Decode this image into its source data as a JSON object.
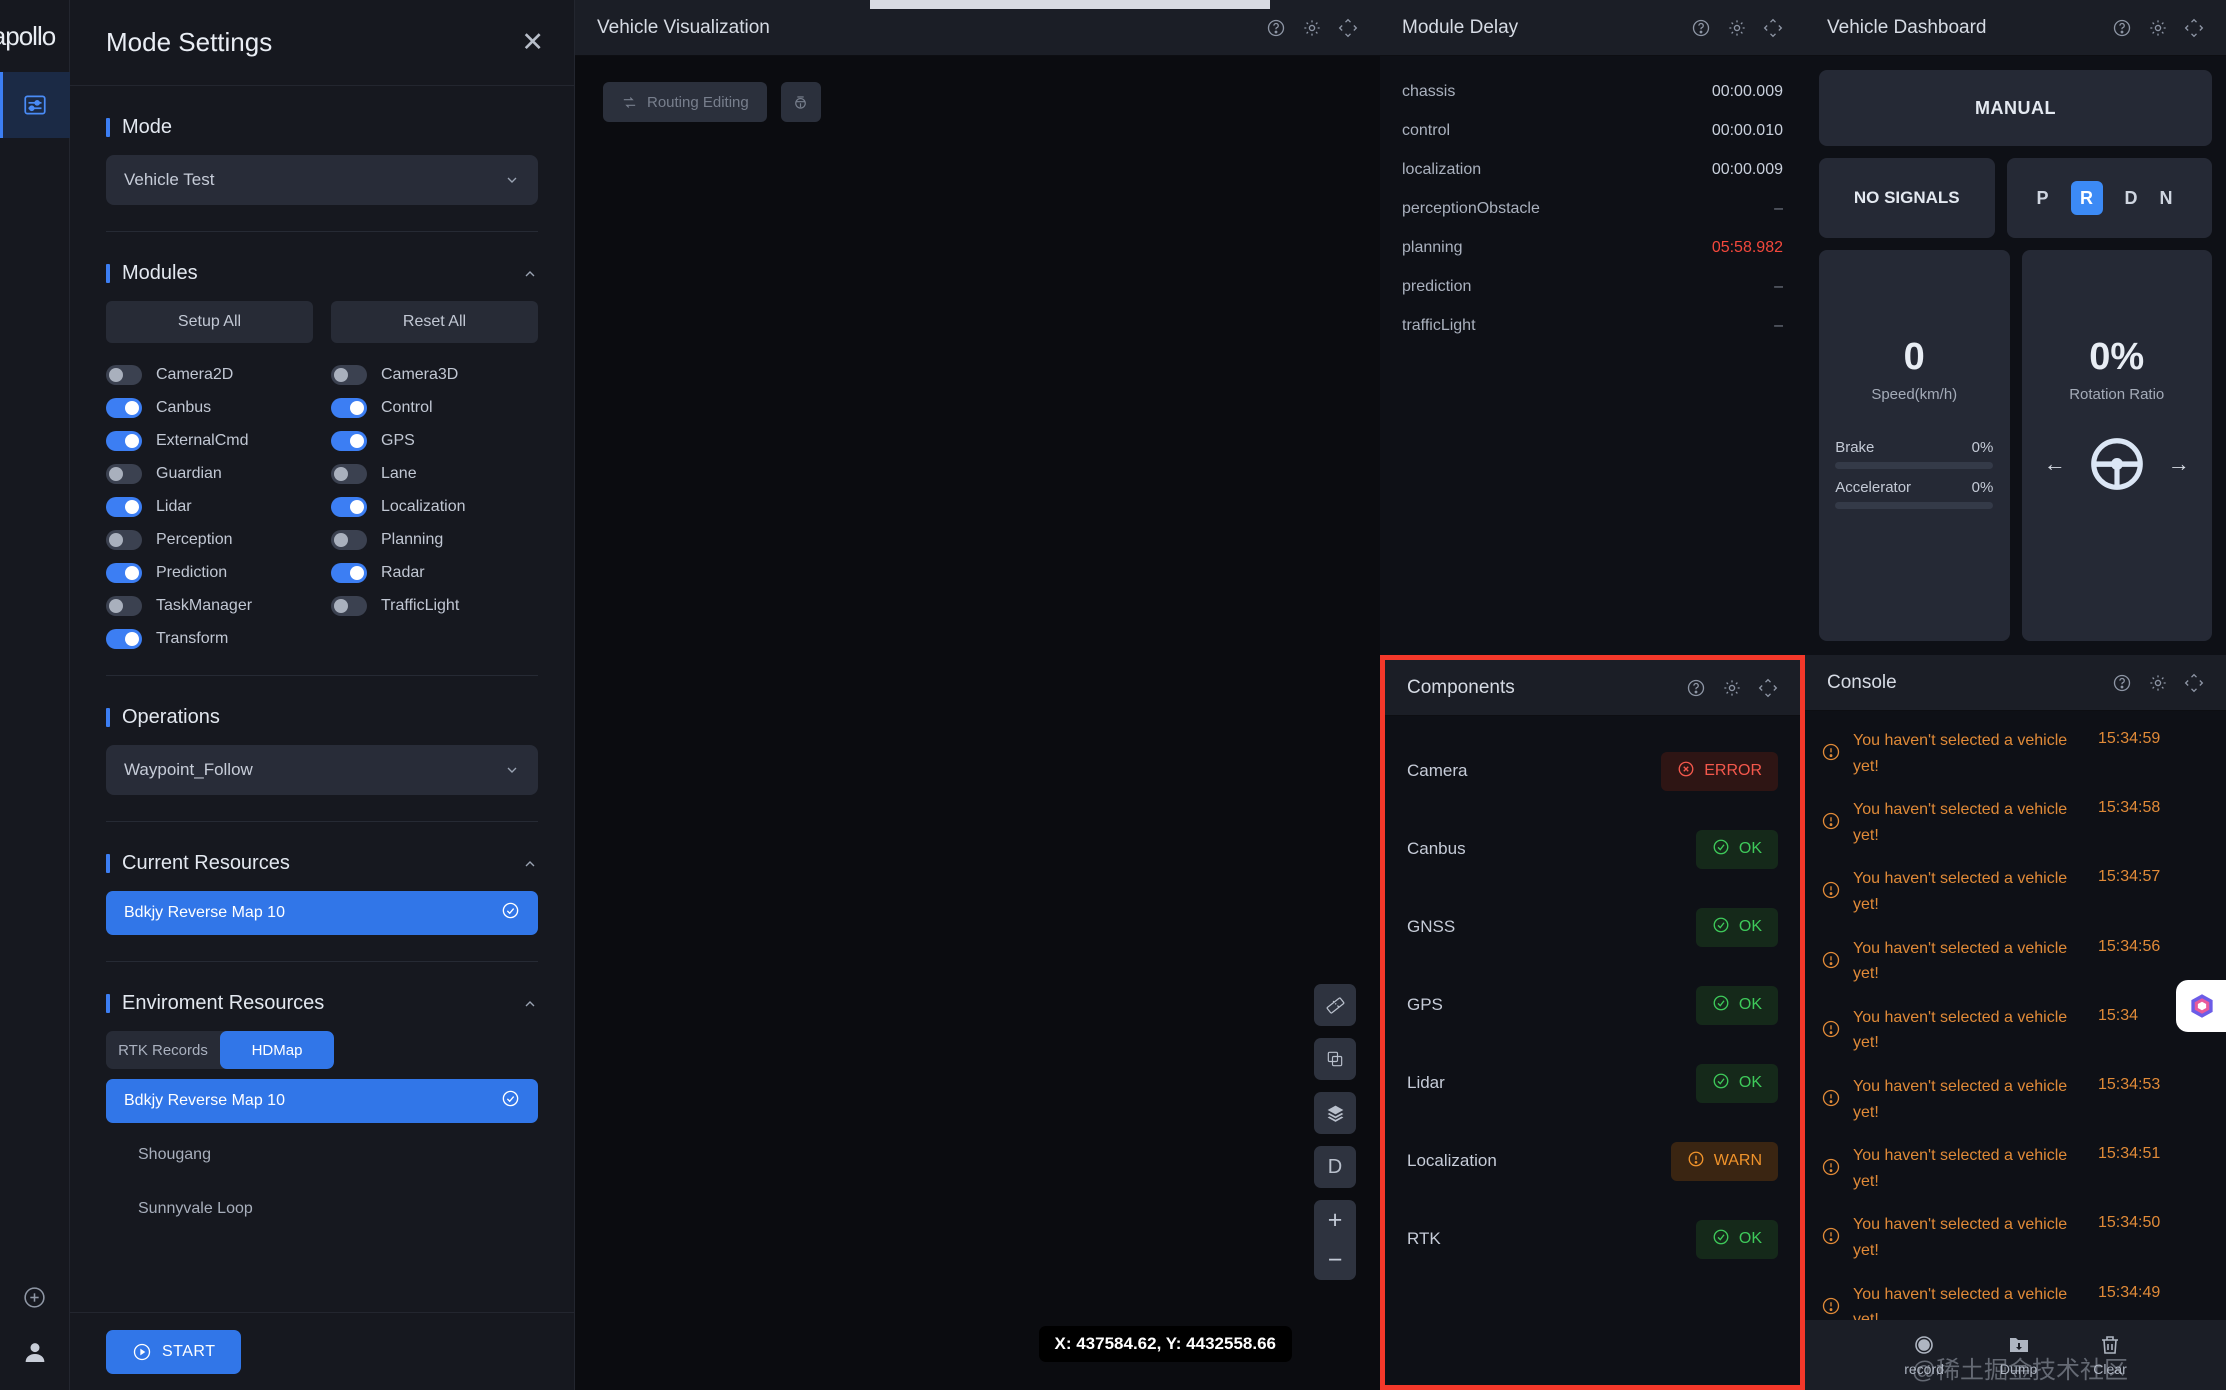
{
  "brand": {
    "logo": "apollo"
  },
  "rail": {
    "settings_icon": "sliders-icon",
    "add_icon": "plus-circle-icon",
    "profile_icon": "user-avatar-icon"
  },
  "mode_settings": {
    "title": "Mode Settings",
    "close_label": "✕",
    "mode": {
      "section": "Mode",
      "selected": "Vehicle Test"
    },
    "modules": {
      "section": "Modules",
      "setup_all": "Setup All",
      "reset_all": "Reset All",
      "items": [
        {
          "label": "Camera2D",
          "on": false
        },
        {
          "label": "Camera3D",
          "on": false
        },
        {
          "label": "Canbus",
          "on": true
        },
        {
          "label": "Control",
          "on": true
        },
        {
          "label": "ExternalCmd",
          "on": true
        },
        {
          "label": "GPS",
          "on": true
        },
        {
          "label": "Guardian",
          "on": false
        },
        {
          "label": "Lane",
          "on": false
        },
        {
          "label": "Lidar",
          "on": true
        },
        {
          "label": "Localization",
          "on": true
        },
        {
          "label": "Perception",
          "on": false
        },
        {
          "label": "Planning",
          "on": false
        },
        {
          "label": "Prediction",
          "on": true
        },
        {
          "label": "Radar",
          "on": true
        },
        {
          "label": "TaskManager",
          "on": false
        },
        {
          "label": "TrafficLight",
          "on": false
        },
        {
          "label": "Transform",
          "on": true
        }
      ]
    },
    "operations": {
      "section": "Operations",
      "selected": "Waypoint_Follow"
    },
    "current_resources": {
      "section": "Current Resources",
      "items": [
        {
          "label": "Bdkjy Reverse Map 10",
          "selected": true
        }
      ]
    },
    "environment_resources": {
      "section": "Enviroment Resources",
      "tabs": [
        {
          "label": "RTK Records",
          "active": false
        },
        {
          "label": "HDMap",
          "active": true
        }
      ],
      "items": [
        {
          "label": "Bdkjy Reverse Map 10",
          "selected": true
        },
        {
          "label": "Shougang",
          "selected": false
        },
        {
          "label": "Sunnyvale Loop",
          "selected": false
        }
      ]
    },
    "start_button": "START"
  },
  "visualization": {
    "title": "Vehicle Visualization",
    "routing_editing": "Routing Editing",
    "coordinates": "X: 437584.62, Y: 4432558.66",
    "tools": [
      {
        "name": "ruler-icon"
      },
      {
        "name": "copy-icon"
      },
      {
        "name": "layers-icon"
      },
      {
        "name": "direction-d-button",
        "label": "D"
      }
    ],
    "zoom_in": "+",
    "zoom_out": "−"
  },
  "module_delay": {
    "title": "Module Delay",
    "rows": [
      {
        "name": "chassis",
        "value": "00:00.009",
        "state": "normal"
      },
      {
        "name": "control",
        "value": "00:00.010",
        "state": "normal"
      },
      {
        "name": "localization",
        "value": "00:00.009",
        "state": "normal"
      },
      {
        "name": "perceptionObstacle",
        "value": "–",
        "state": "dash"
      },
      {
        "name": "planning",
        "value": "05:58.982",
        "state": "bad"
      },
      {
        "name": "prediction",
        "value": "–",
        "state": "dash"
      },
      {
        "name": "trafficLight",
        "value": "–",
        "state": "dash"
      }
    ]
  },
  "dashboard": {
    "title": "Vehicle Dashboard",
    "drive_mode": "MANUAL",
    "signal": "NO SIGNALS",
    "gears": [
      {
        "label": "P",
        "active": false
      },
      {
        "label": "R",
        "active": true
      },
      {
        "label": "D",
        "active": false
      },
      {
        "label": "N",
        "active": false
      }
    ],
    "speed_value": "0",
    "speed_label": "Speed(km/h)",
    "rotation_value": "0%",
    "rotation_label": "Rotation Ratio",
    "brake_label": "Brake",
    "brake_value": "0%",
    "accelerator_label": "Accelerator",
    "accelerator_value": "0%"
  },
  "components": {
    "title": "Components",
    "highlighted": true,
    "highlight_color": "#f4382a",
    "rows": [
      {
        "name": "Camera",
        "status": "ERROR",
        "kind": "error"
      },
      {
        "name": "Canbus",
        "status": "OK",
        "kind": "ok"
      },
      {
        "name": "GNSS",
        "status": "OK",
        "kind": "ok"
      },
      {
        "name": "GPS",
        "status": "OK",
        "kind": "ok"
      },
      {
        "name": "Lidar",
        "status": "OK",
        "kind": "ok"
      },
      {
        "name": "Localization",
        "status": "WARN",
        "kind": "warn"
      },
      {
        "name": "RTK",
        "status": "OK",
        "kind": "ok"
      }
    ]
  },
  "console": {
    "title": "Console",
    "entries": [
      {
        "message": "You haven't selected a vehicle yet!",
        "time": "15:34:59"
      },
      {
        "message": "You haven't selected a vehicle yet!",
        "time": "15:34:58"
      },
      {
        "message": "You haven't selected a vehicle yet!",
        "time": "15:34:57"
      },
      {
        "message": "You haven't selected a vehicle yet!",
        "time": "15:34:56"
      },
      {
        "message": "You haven't selected a vehicle yet!",
        "time": "15:34"
      },
      {
        "message": "You haven't selected a vehicle yet!",
        "time": "15:34:53"
      },
      {
        "message": "You haven't selected a vehicle yet!",
        "time": "15:34:51"
      },
      {
        "message": "You haven't selected a vehicle yet!",
        "time": "15:34:50"
      },
      {
        "message": "You haven't selected a vehicle yet!",
        "time": "15:34:49"
      }
    ]
  },
  "footer": {
    "record": "record",
    "dump": "Dump",
    "clear": "Clear",
    "watermark": "@稀土掘金技术社区"
  },
  "colors": {
    "accent": "#3c7ef3",
    "error": "#f4584c",
    "ok": "#3ec95a",
    "warn": "#f0932b",
    "highlight": "#f4382a"
  }
}
